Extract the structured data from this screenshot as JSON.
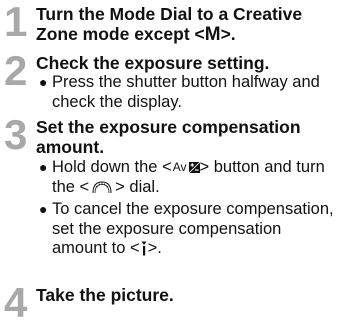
{
  "steps": [
    {
      "number": "1",
      "title_before": "Turn the Mode Dial to a Creative Zone mode except <",
      "title_symbol": "M",
      "title_after": ">."
    },
    {
      "number": "2",
      "title": "Check the exposure setting.",
      "bullets": [
        {
          "text": "Press the shutter button halfway and check the display."
        }
      ]
    },
    {
      "number": "3",
      "title": "Set the exposure compensation amount.",
      "bullets": [
        {
          "before": "Hold down the <",
          "button_label": "Av",
          "button_icon": "exposure-compensation-icon",
          "middle": "> button and turn the <",
          "dial_icon": "main-dial-icon",
          "after": "> dial."
        },
        {
          "before": "To cancel the exposure compensation, set the exposure compensation amount to <",
          "zero_icon": "zero-index-icon",
          "after": ">."
        }
      ]
    },
    {
      "number": "4",
      "title": "Take the picture."
    }
  ],
  "colors": {
    "step_number": "#a8a8a8",
    "text": "#111111"
  }
}
